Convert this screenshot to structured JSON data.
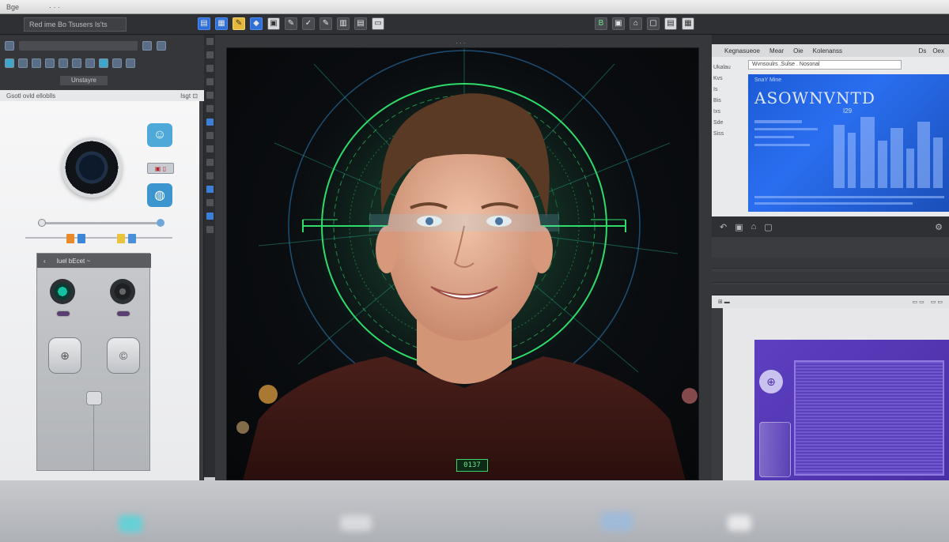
{
  "window": {
    "title_left": "Bge",
    "title_center": "· · ·"
  },
  "main_toolbar": {
    "document_tab": "Red ime Bo Tsusers Is'ts",
    "tools_center": [
      "▤",
      "▦",
      "✎",
      "◆",
      "▣",
      "✎",
      "✓",
      "✎",
      "▥",
      "▤",
      "▭"
    ],
    "tools_right": [
      "B",
      "▣",
      "⌂",
      "▢",
      "▤",
      "▦"
    ]
  },
  "left_panel": {
    "tab_label": "Unstayre",
    "subheader_left": "Gsotl ovld elloblls",
    "subheader_right": "Isgt ⊡",
    "badge_label": "▣ ▯",
    "device_header": "Iuel bEcet ~",
    "device_back": "‹",
    "button_left_glyph": "⊕",
    "button_right_glyph": "©"
  },
  "canvas": {
    "face_tag": "0137"
  },
  "right_panel": {
    "menu_items": [
      "Kegnasueoe",
      "Mear",
      "Oie",
      "Kolenanss"
    ],
    "menu_right": [
      "Ds",
      "Oex"
    ],
    "address": "Wvnsoulrs .Sulse . Nosonal",
    "web_sub": "SnaY Mine",
    "web_title": "ASOWNVNTD",
    "web_badge": "I29",
    "side_list": [
      "Ukalau",
      "Kvs",
      "Is",
      "Bis",
      "Ixs",
      "Sde",
      "Siss"
    ],
    "prop_strip_items": [
      "⊞ ▬",
      "▭ ▭",
      "▭ ▭"
    ],
    "purple_logo_glyph": "⊕"
  },
  "colors": {
    "accent_blue": "#2f6fd6",
    "scan_green": "#2fdc6a",
    "purple": "#5d3fc0",
    "ui_dark": "#2f3033"
  }
}
